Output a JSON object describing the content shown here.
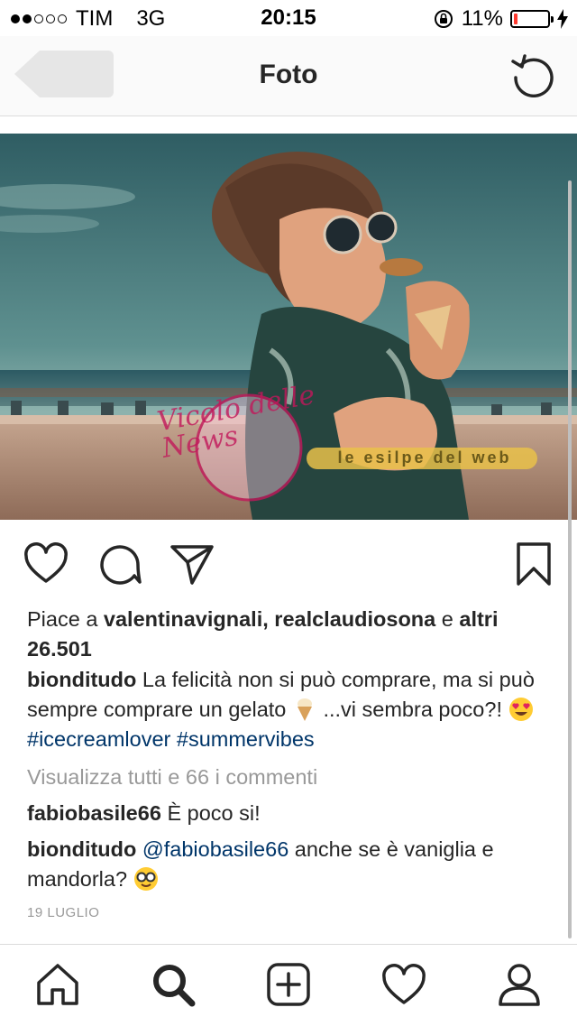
{
  "status": {
    "carrier": "TIM",
    "network": "3G",
    "time": "20:15",
    "battery": "11%",
    "battery_level": 0.11,
    "signal_bars": 2
  },
  "nav": {
    "title": "Foto",
    "back_icon": "back-arrow-icon",
    "refresh_icon": "refresh-icon"
  },
  "photo": {
    "alt": "Woman with sunglasses eating an ice cream cone by the sea",
    "watermark_left": "Vicolo delle News",
    "watermark_right": "le esilpe del web"
  },
  "post": {
    "likes_prefix": "Piace a",
    "liker_1": "valentinavignali",
    "liker_sep": ",",
    "liker_2": "realclaudiosona",
    "likes_and": "e",
    "likes_others": "altri 26.501",
    "caption_user": "bionditudo",
    "caption_text_1": "La felicità non si può comprare, ma si può sempre comprare un gelato",
    "caption_text_2": "...vi sembra poco?!",
    "hashtag_1": "#icecreamlover",
    "hashtag_2": "#summervibes",
    "view_comments": "Visualizza tutti e 66 i commenti",
    "comments": [
      {
        "user": "fabiobasile66",
        "text": "È poco si!"
      },
      {
        "user": "bionditudo",
        "mention": "@fabiobasile66",
        "text": "anche se è vaniglia e mandorla?"
      }
    ],
    "date": "19 LUGLIO"
  },
  "tabs": [
    "home-icon",
    "search-icon",
    "add-post-icon",
    "activity-heart-icon",
    "profile-icon"
  ]
}
